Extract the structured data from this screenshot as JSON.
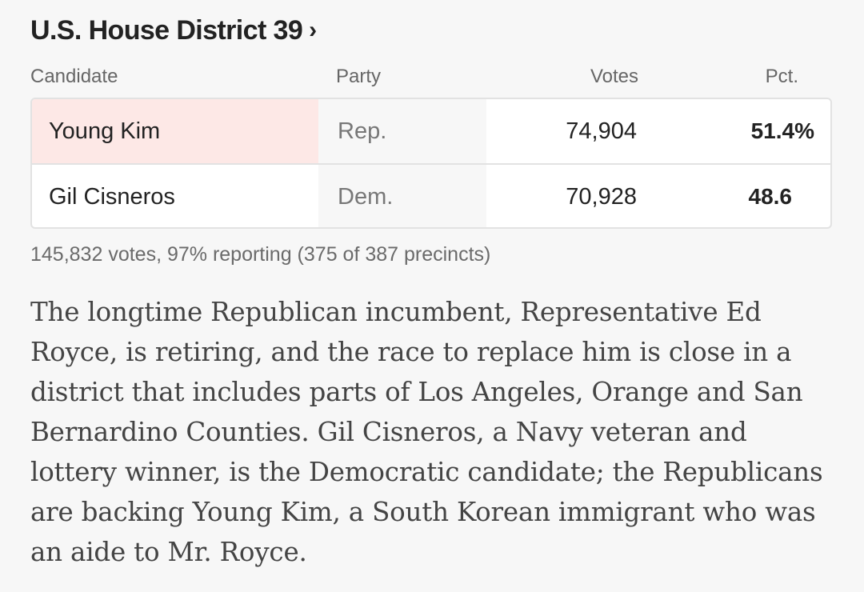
{
  "header": {
    "title": "U.S. House District 39",
    "chevron": "›"
  },
  "table": {
    "columns": {
      "candidate": "Candidate",
      "party": "Party",
      "votes": "Votes",
      "pct": "Pct."
    },
    "rows": [
      {
        "candidate": "Young Kim",
        "party": "Rep.",
        "votes": "74,904",
        "pct": "51.4%",
        "winner": true
      },
      {
        "candidate": "Gil Cisneros",
        "party": "Dem.",
        "votes": "70,928",
        "pct": "48.6",
        "winner": false
      }
    ]
  },
  "reporting": "145,832 votes, 97% reporting (375 of 387 precincts)",
  "summary": "The longtime Republican incumbent, Representative Ed Royce, is retiring, and the race to replace him is close in a district that includes parts of Los Angeles, Orange and San Bernardino Counties. Gil Cisneros, a Navy veteran and lottery winner, is the Democratic candidate; the Republicans are backing Young Kim, a South Korean immigrant who was an aide to Mr. Royce.",
  "colors": {
    "winner_highlight": "#fde8e6",
    "background": "#f7f7f7"
  }
}
